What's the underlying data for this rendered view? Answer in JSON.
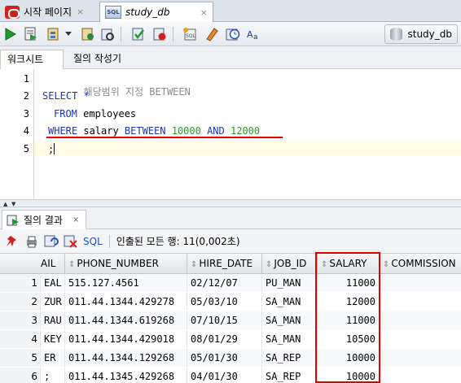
{
  "doc_tabs": [
    {
      "label": "시작 페이지",
      "close": "×"
    },
    {
      "label": "study_db",
      "close": "×"
    }
  ],
  "toolbar": {
    "connection_label": "study_db"
  },
  "subtabs": [
    "워크시트",
    "질의 작성기"
  ],
  "editor": {
    "line_numbers": [
      "1",
      "2",
      "3",
      "4",
      "5"
    ],
    "lines": [
      {
        "comment": "-- 해당범위 지정 BETWEEN"
      },
      {
        "kw1": "SELECT",
        "rest": " *"
      },
      {
        "kw1": "FROM",
        "rest": " employees"
      },
      {
        "kw1": "WHERE",
        "ident": " salary ",
        "kw2": "BETWEEN",
        "n1": " 10000 ",
        "kw3": "AND",
        "n2": " 12000"
      },
      {
        "rest": ";"
      }
    ]
  },
  "results": {
    "tab_label": "질의 결과",
    "tab_close": "×",
    "sql_label": "SQL",
    "status": "인출된 모든 행: 11(0,002초)",
    "columns": [
      "AIL",
      "PHONE_NUMBER",
      "HIRE_DATE",
      "JOB_ID",
      "SALARY",
      "COMMISSION"
    ],
    "rows": [
      {
        "n": "1",
        "email": "EAL",
        "phone": "515.127.4561",
        "hire": "02/12/07",
        "job": "PU_MAN",
        "salary": "11000"
      },
      {
        "n": "2",
        "email": "ZUR",
        "phone": "011.44.1344.429278",
        "hire": "05/03/10",
        "job": "SA_MAN",
        "salary": "12000"
      },
      {
        "n": "3",
        "email": "RAU",
        "phone": "011.44.1344.619268",
        "hire": "07/10/15",
        "job": "SA_MAN",
        "salary": "11000"
      },
      {
        "n": "4",
        "email": "KEY",
        "phone": "011.44.1344.429018",
        "hire": "08/01/29",
        "job": "SA_MAN",
        "salary": "10500"
      },
      {
        "n": "5",
        "email": "ER",
        "phone": "011.44.1344.129268",
        "hire": "05/01/30",
        "job": "SA_REP",
        "salary": "10000"
      },
      {
        "n": "6",
        "email": ";",
        "phone": "011.44.1345.429268",
        "hire": "04/01/30",
        "job": "SA_REP",
        "salary": "10000"
      }
    ]
  },
  "icons": [
    "oracle-icon",
    "sql-worksheet-icon",
    "run-icon",
    "run-script-icon",
    "explain-plan-icon",
    "autotrace-icon",
    "commit-icon",
    "rollback-icon",
    "unshared-sql-icon",
    "clear-icon",
    "history-icon",
    "format-icon",
    "database-icon",
    "pin-icon",
    "print-icon",
    "refresh-icon",
    "export-icon"
  ],
  "colors": {
    "keyword": "#1c34c6",
    "number": "#2a9a2a",
    "comment": "#8c8c8c",
    "highlight": "#e00000"
  }
}
